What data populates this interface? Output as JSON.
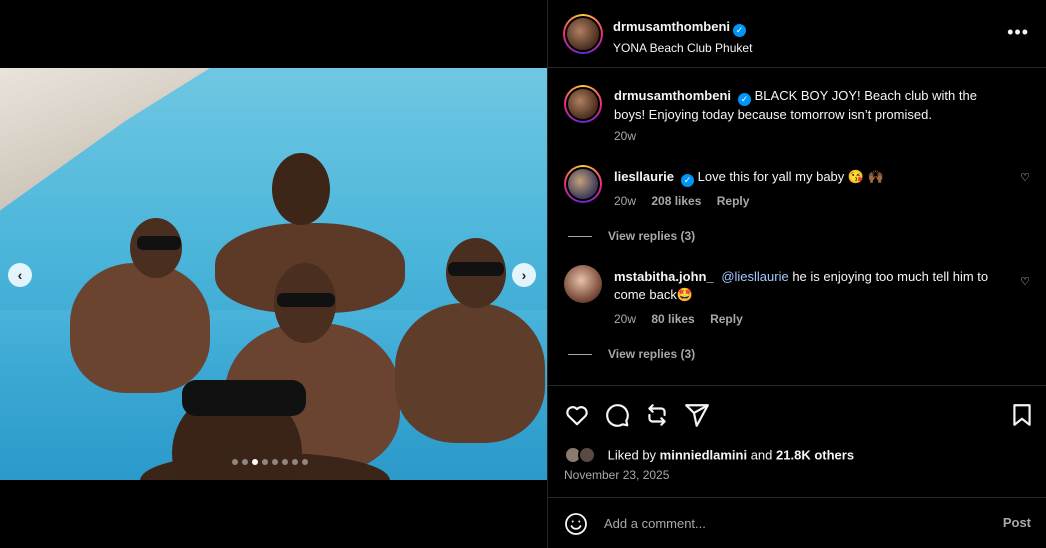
{
  "post": {
    "author": "drmusamthombeni",
    "location": "YONA Beach Club Phuket"
  },
  "caption": {
    "username": "drmusamthombeni",
    "text": "BLACK BOY JOY! Beach club with the boys! Enjoying today because tomorrow isn’t promised.",
    "time": "20w"
  },
  "comments": [
    {
      "username": "liesllaurie",
      "verified": true,
      "text": "Love this for yall my baby 😘 🙌🏾",
      "time": "20w",
      "likes": "208 likes",
      "reply": "Reply",
      "view_replies": "View replies (3)"
    },
    {
      "username": "mstabitha.john_",
      "verified": false,
      "mention": "@liesllaurie",
      "text": "he is enjoying too much tell him to come back🤩",
      "time": "20w",
      "likes": "80 likes",
      "reply": "Reply",
      "view_replies": "View replies (3)"
    }
  ],
  "liked_by": {
    "prefix": "Liked by",
    "user": "minniedlamini",
    "and": "and",
    "others": "21.8K others"
  },
  "date": "November 23, 2025",
  "add_comment": {
    "placeholder": "Add a comment...",
    "post_label": "Post"
  },
  "icons": {
    "more": "more-horizontal-icon",
    "like": "heart-icon",
    "comment": "comment-icon",
    "share": "repost-icon",
    "send": "send-icon",
    "save": "bookmark-icon",
    "emoji": "emoji-icon",
    "prev": "chevron-left-icon",
    "next": "chevron-right-icon"
  },
  "carousel": {
    "slides": 8,
    "active_index": 2
  },
  "colors": {
    "verified": "#0095f6",
    "background": "#000000",
    "muted": "#a8a8a8"
  }
}
